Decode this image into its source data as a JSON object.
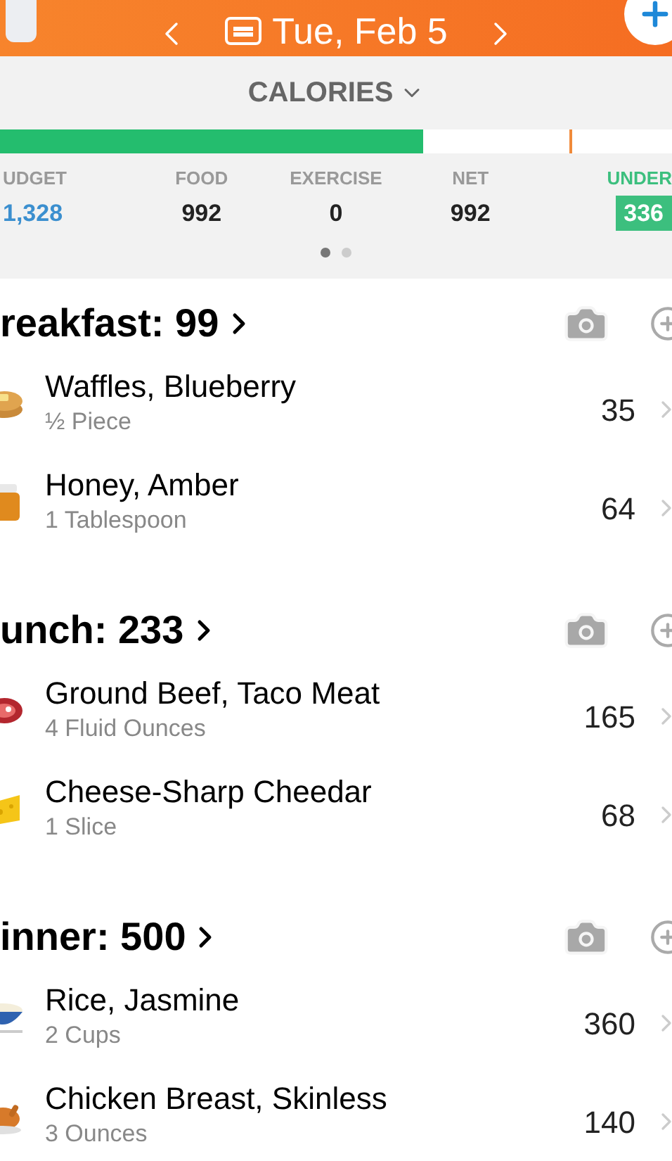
{
  "header": {
    "date": "Tue, Feb 5"
  },
  "summary": {
    "title": "CALORIES",
    "level": 0.63,
    "stats": [
      {
        "label": "UDGET",
        "value": "1,328",
        "kind": "budget"
      },
      {
        "label": "FOOD",
        "value": "992",
        "kind": "plain"
      },
      {
        "label": "EXERCISE",
        "value": "0",
        "kind": "plain"
      },
      {
        "label": "NET",
        "value": "992",
        "kind": "plain"
      },
      {
        "label": "UNDER",
        "value": "336",
        "kind": "under"
      }
    ],
    "pages": [
      {
        "selected": true
      },
      {
        "selected": false
      }
    ]
  },
  "meals": [
    {
      "title": "reakfast: 99",
      "items": [
        {
          "name": "Waffles, Blueberry",
          "amount": "½ Piece",
          "calories": "35",
          "kind": "waffle"
        },
        {
          "name": "Honey, Amber",
          "amount": "1 Tablespoon",
          "calories": "64",
          "kind": "honey"
        }
      ]
    },
    {
      "title": "unch: 233",
      "items": [
        {
          "name": "Ground Beef, Taco Meat",
          "amount": "4 Fluid Ounces",
          "calories": "165",
          "kind": "meat"
        },
        {
          "name": "Cheese-Sharp Cheedar",
          "amount": "1 Slice",
          "calories": "68",
          "kind": "cheese"
        }
      ]
    },
    {
      "title": "inner: 500",
      "items": [
        {
          "name": "Rice, Jasmine",
          "amount": "2 Cups",
          "calories": "360",
          "kind": "rice"
        },
        {
          "name": "Chicken Breast, Skinless",
          "amount": "3 Ounces",
          "calories": "140",
          "kind": "chicken"
        }
      ]
    }
  ]
}
